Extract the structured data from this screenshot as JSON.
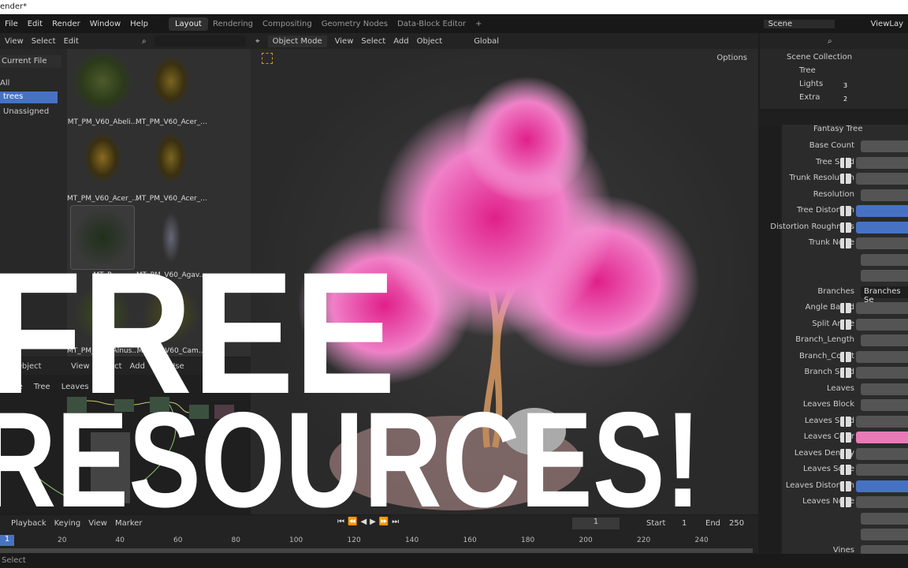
{
  "window": {
    "title": "ender*"
  },
  "menu": [
    "File",
    "Edit",
    "Render",
    "Window",
    "Help"
  ],
  "workspaces": [
    "Layout",
    "Rendering",
    "Compositing",
    "Geometry Nodes",
    "Data-Block Editor",
    "+"
  ],
  "scene": "Scene",
  "view_layer": "ViewLay",
  "asset_browser": {
    "header": [
      "View",
      "Select",
      "Edit"
    ],
    "library": "Current File",
    "catalogs": [
      "All",
      "trees",
      "Unassigned"
    ],
    "assets": [
      "MT_PM_V60_Abeli...",
      "MT_PM_V60_Acer_...",
      "MT_PM_V60_Acer_...",
      "MT_PM_V60_Acer_...",
      "MT_P",
      "MT_PM_V60_Agav...",
      "MT_PM_V60_Alnus...",
      "MT_PM_V60_Cam..."
    ]
  },
  "node_editor": {
    "header": [
      "Object",
      "View",
      "Select",
      "Add"
    ],
    "use_nodes": "Use",
    "breadcrumb": [
      "Tree",
      "Tree",
      "Leaves"
    ]
  },
  "viewport": {
    "mode": "Object Mode",
    "header": [
      "View",
      "Select",
      "Add",
      "Object"
    ],
    "orientation": "Global",
    "options": "Options"
  },
  "outliner": {
    "root": "Scene Collection",
    "items": [
      {
        "name": "Tree",
        "badge": ""
      },
      {
        "name": "Lights",
        "badge": "3"
      },
      {
        "name": "Extra",
        "badge": "2"
      }
    ]
  },
  "properties": {
    "modifier": "Fantasy Tree",
    "branches_value": "Branches Se",
    "rows": [
      "Base Count",
      "Tree Seed",
      "Trunk Resolution",
      "Resolution",
      "Tree Distortion",
      "Distortion Roughness",
      "Trunk Noise",
      "",
      "",
      "Branches",
      "Angle Based",
      "Split Angle",
      "Branch_Length",
      "Branch_Count",
      "Branch Seed",
      "Leaves",
      "Leaves Block",
      "Leaves Seed",
      "Leaves Color",
      "Leaves Density",
      "Leaves Scale",
      "Leaves Distortion",
      "Leaves Noise",
      "",
      "",
      "Vines"
    ],
    "colors": {
      "blue": "#4772c4",
      "pink": "#e87ab8"
    }
  },
  "timeline": {
    "header": [
      "Playback",
      "Keying",
      "View",
      "Marker"
    ],
    "current": "1",
    "start_label": "Start",
    "start": "1",
    "end_label": "End",
    "end": "250",
    "ticks": [
      "20",
      "40",
      "60",
      "80",
      "100",
      "120",
      "140",
      "160",
      "180",
      "200",
      "220",
      "240"
    ],
    "frame_badge": "1"
  },
  "status": {
    "left": "Select"
  },
  "overlay": {
    "line1": "FREE",
    "line2": "RESOURCES!"
  }
}
